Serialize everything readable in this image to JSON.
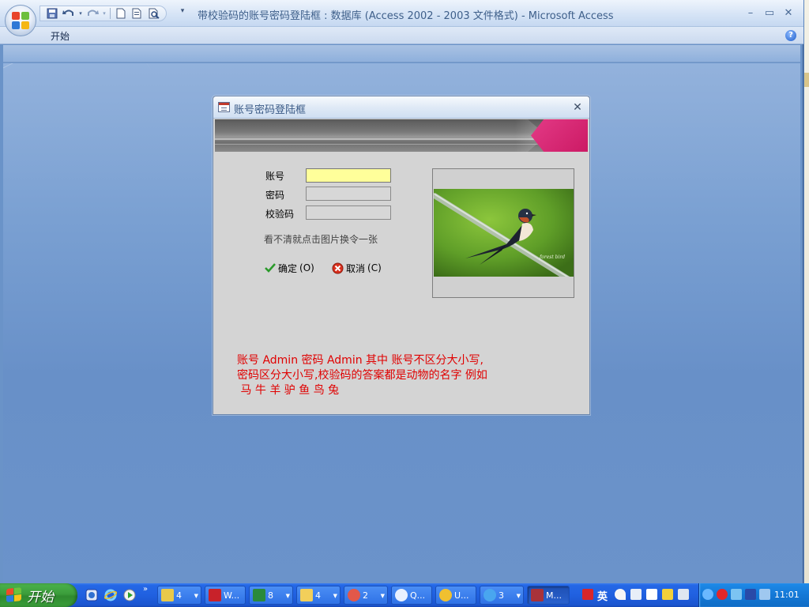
{
  "window": {
    "title": "带校验码的账号密码登陆框 : 数据库 (Access 2002 - 2003 文件格式) - Microsoft Access",
    "minimize": "–",
    "maximize": "▭",
    "close": "✕"
  },
  "ribbon": {
    "tabs": [
      {
        "label": "开始"
      }
    ],
    "help": "?"
  },
  "dialog": {
    "title": "账号密码登陆框",
    "close": "✕",
    "fields": {
      "account_label": "账号",
      "password_label": "密码",
      "captcha_label": "校验码",
      "account_value": "",
      "password_value": "",
      "captcha_value": ""
    },
    "hint": "看不清就点击图片换令一张",
    "ok_button": {
      "label": "确定",
      "accel": "(O)"
    },
    "cancel_button": {
      "label": "取消",
      "accel": "(C)"
    },
    "notice_lines": [
      "账号 Admin 密码 Admin 其中 账号不区分大小写,",
      "密码区分大小写,校验码的答案都是动物的名字 例如",
      " 马 牛 羊 驴 鱼 鸟 兔"
    ],
    "colors": {
      "notice": "#e00000",
      "account_bg": "#ffff9a",
      "banner_accent": "#e33a86"
    }
  },
  "taskbar": {
    "start_label": "开始",
    "quick_launch_more": "»",
    "tasks": [
      {
        "label": "4",
        "icon": "folder-group-icon"
      },
      {
        "label": "W...",
        "icon": "wps-writer-icon"
      },
      {
        "label": "8",
        "icon": "excel-icon"
      },
      {
        "label": "4",
        "icon": "folder-icon"
      },
      {
        "label": "2",
        "icon": "browser-icon"
      },
      {
        "label": "Q...",
        "icon": "qq-icon"
      },
      {
        "label": "U...",
        "icon": "player-icon"
      },
      {
        "label": "3",
        "icon": "ie-icon"
      },
      {
        "label": "M...",
        "icon": "access-icon"
      }
    ],
    "ime": "英",
    "clock": "11:01"
  }
}
